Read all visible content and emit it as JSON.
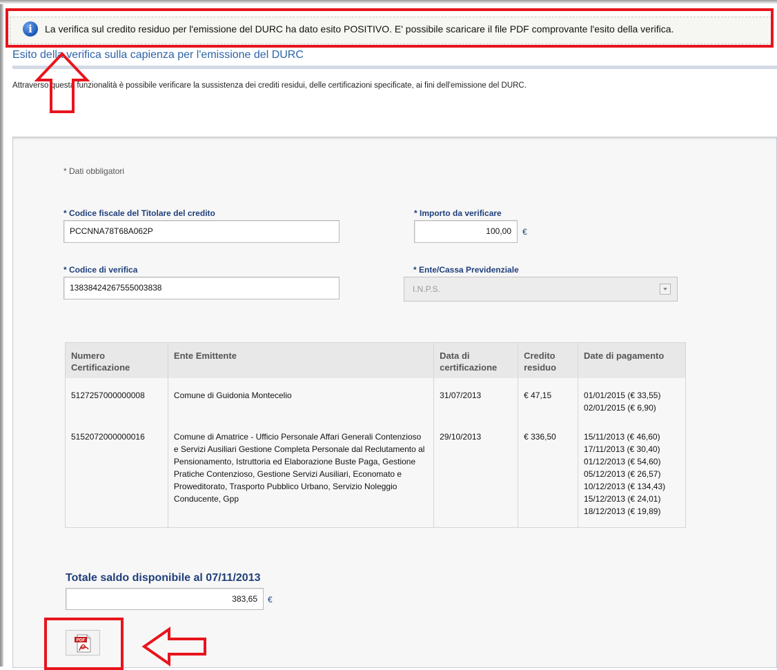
{
  "notice": {
    "message": "La verifica sul credito residuo per l'emissione del DURC ha dato esito POSITIVO. E' possibile scaricare il file PDF comprovante l'esito della verifica."
  },
  "page": {
    "title": "Esito della verifica sulla capienza per l'emissione del DURC",
    "description": "Attraverso questa funzionalità è possibile verificare la sussistenza dei crediti residui, delle certificazioni specificate, ai fini dell'emissione del DURC."
  },
  "form": {
    "required_note": "* Dati obbligatori",
    "codice_fiscale": {
      "label": "* Codice fiscale del Titolare del credito",
      "value": "PCCNNA78T68A062P"
    },
    "importo": {
      "label": "* Importo da verificare",
      "value": "100,00",
      "currency": "€"
    },
    "codice_verifica": {
      "label": "* Codice di verifica",
      "value": "13838424267555003838"
    },
    "ente": {
      "label": "* Ente/Cassa Previdenziale",
      "value": "I.N.P.S."
    }
  },
  "table": {
    "headers": [
      "Numero Certificazione",
      "Ente Emittente",
      "Data di certificazione",
      "Credito residuo",
      "Date di pagamento"
    ],
    "rows": [
      {
        "numero": "5127257000000008",
        "ente": "Comune di Guidonia Montecelio",
        "data": "31/07/2013",
        "credito": "€  47,15",
        "pagamenti": [
          "01/01/2015 (€ 33,55)",
          "02/01/2015 (€ 6,90)"
        ]
      },
      {
        "numero": "5152072000000016",
        "ente": "Comune di Amatrice - Ufficio Personale Affari Generali Contenzioso e Servizi Ausiliari Gestione Completa Personale dal Reclutamento al Pensionamento, Istruttoria ed Elaborazione Buste Paga, Gestione Pratiche Contenzioso, Gestione Servizi Ausiliari, Economato e Proweditorato, Trasporto Pubblico Urbano, Servizio Noleggio Conducente, Gpp",
        "data": "29/10/2013",
        "credito": "€  336,50",
        "pagamenti": [
          "15/11/2013 (€ 46,60)",
          "17/11/2013 (€ 30,40)",
          "01/12/2013 (€ 54,60)",
          "05/12/2013 (€ 26,57)",
          "10/12/2013 (€ 134,43)",
          "15/12/2013 (€ 24,01)",
          "18/12/2013 (€ 19,89)"
        ]
      }
    ]
  },
  "totale": {
    "label": "Totale saldo disponibile al 07/11/2013",
    "value": "383,65",
    "currency": "€"
  },
  "pdf": {
    "icon": "pdf-file-icon",
    "badge": "PDF"
  },
  "colors": {
    "highlight": "#e8141c",
    "label": "#1f3f7a",
    "title": "#2e63a8",
    "info": "#1b58b8"
  }
}
